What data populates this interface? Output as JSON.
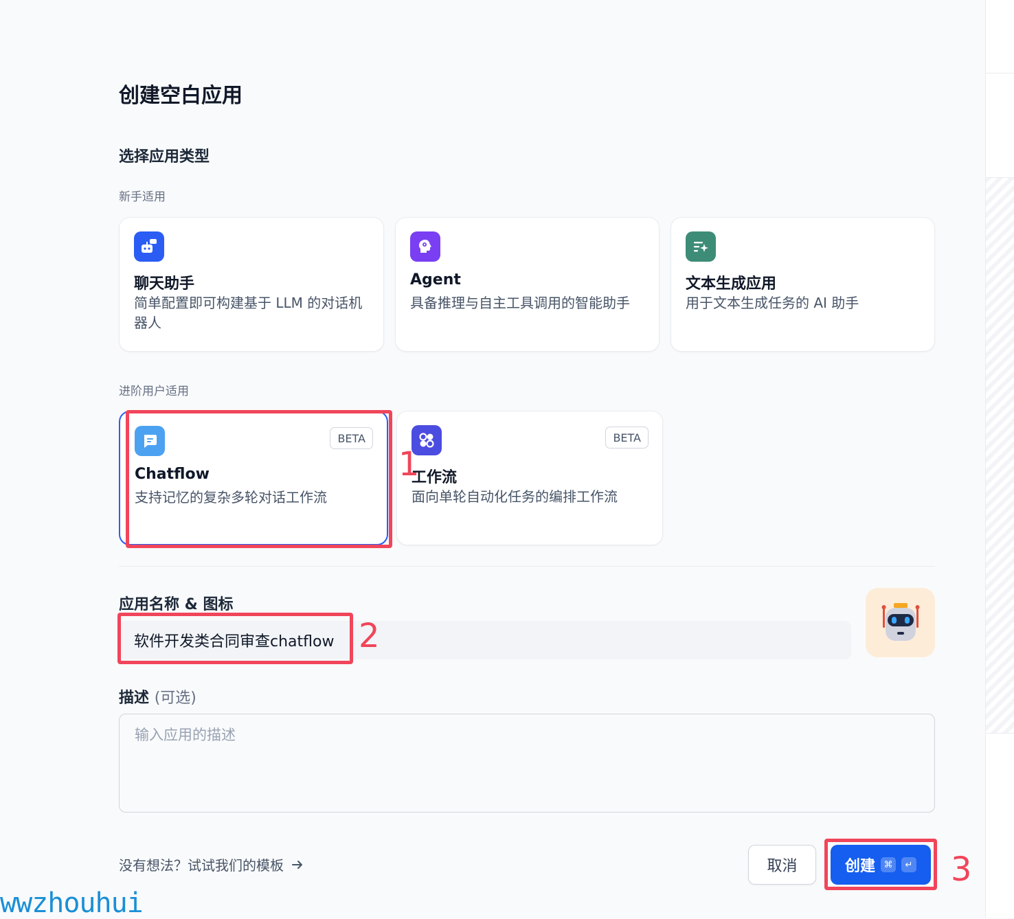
{
  "modal": {
    "title": "创建空白应用",
    "section_title": "选择应用类型",
    "group_beginner": "新手适用",
    "group_advanced": "进阶用户适用"
  },
  "cards": {
    "chat": {
      "name": "聊天助手",
      "desc": "简单配置即可构建基于 LLM 的对话机器人",
      "icon": "chat-bot-icon",
      "color": "#2b5df5"
    },
    "agent": {
      "name": "Agent",
      "desc": "具备推理与自主工具调用的智能助手",
      "icon": "brain-head-icon",
      "color": "#7a3ff2"
    },
    "text": {
      "name": "文本生成应用",
      "desc": "用于文本生成任务的 AI 助手",
      "icon": "text-sparkle-icon",
      "color": "#3d8c77"
    },
    "chatflow": {
      "name": "Chatflow",
      "desc": "支持记忆的复杂多轮对话工作流",
      "badge": "BETA",
      "icon": "chat-bubble-icon",
      "color": "#4ca2f0"
    },
    "workflow": {
      "name": "工作流",
      "desc": "面向单轮自动化任务的编排工作流",
      "badge": "BETA",
      "icon": "workflow-nodes-icon",
      "color": "#4b4ce0"
    }
  },
  "form": {
    "name_label": "应用名称 & 图标",
    "name_value": "软件开发类合同审查chatflow",
    "app_icon": "robot-icon",
    "desc_label": "描述",
    "desc_optional": "(可选)",
    "desc_placeholder": "输入应用的描述"
  },
  "footer": {
    "template_link": "没有想法？试试我们的模板",
    "cancel": "取消",
    "create": "创建",
    "kbd_cmd": "⌘",
    "kbd_enter": "↵"
  },
  "annotations": {
    "n1": "1",
    "n2": "2",
    "n3": "3"
  },
  "watermark": "wwzhouhui",
  "colors": {
    "accent": "#155eef",
    "annotation": "#f0455a"
  }
}
